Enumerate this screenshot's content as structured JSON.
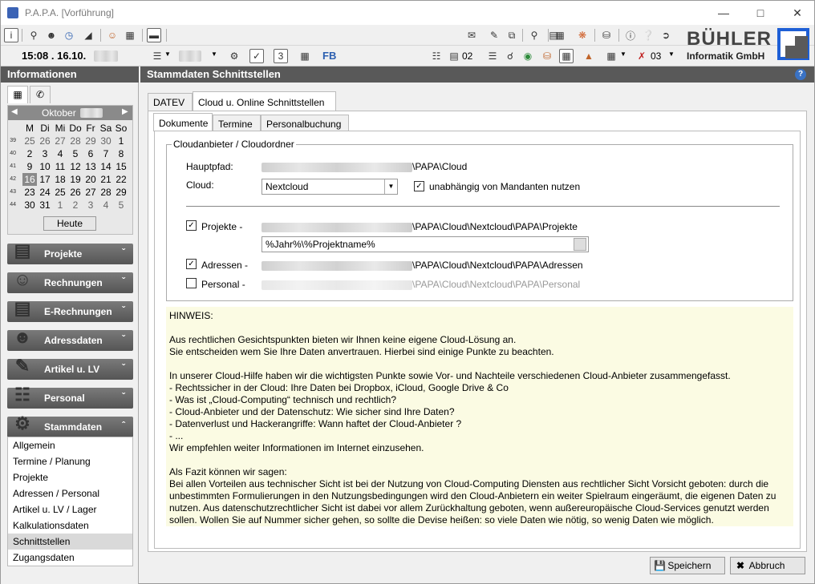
{
  "window": {
    "title": "P.A.P.A. [Vorführung]"
  },
  "toolbar2": {
    "clock": "15:08 . 16.10.",
    "fb_label": "FB",
    "counter1": "02",
    "counter2": "03"
  },
  "brand": {
    "name": "BÜHLER",
    "sub": "Informatik GmbH"
  },
  "left": {
    "header": "Informationen",
    "calendar": {
      "month": "Oktober",
      "weekdays": [
        "M",
        "Di",
        "Mi",
        "Do",
        "Fr",
        "Sa",
        "So"
      ],
      "weeks": [
        {
          "wk": "39",
          "days": [
            "25",
            "26",
            "27",
            "28",
            "29",
            "30",
            "1"
          ]
        },
        {
          "wk": "40",
          "days": [
            "2",
            "3",
            "4",
            "5",
            "6",
            "7",
            "8"
          ]
        },
        {
          "wk": "41",
          "days": [
            "9",
            "10",
            "11",
            "12",
            "13",
            "14",
            "15"
          ]
        },
        {
          "wk": "42",
          "days": [
            "16",
            "17",
            "18",
            "19",
            "20",
            "21",
            "22"
          ]
        },
        {
          "wk": "43",
          "days": [
            "23",
            "24",
            "25",
            "26",
            "27",
            "28",
            "29"
          ]
        },
        {
          "wk": "44",
          "days": [
            "30",
            "31",
            "1",
            "2",
            "3",
            "4",
            "5"
          ]
        }
      ],
      "today_label": "Heute"
    },
    "nav": [
      {
        "label": "Projekte"
      },
      {
        "label": "Rechnungen"
      },
      {
        "label": "E-Rechnungen"
      },
      {
        "label": "Adressdaten"
      },
      {
        "label": "Artikel u. LV"
      },
      {
        "label": "Personal"
      },
      {
        "label": "Stammdaten"
      }
    ],
    "submenu": [
      "Allgemein",
      "Termine / Planung",
      "Projekte",
      "Adressen / Personal",
      "Artikel u. LV / Lager",
      "Kalkulationsdaten",
      "Schnittstellen",
      "Zugangsdaten"
    ]
  },
  "main": {
    "header": "Stammdaten Schnittstellen",
    "tabs": [
      "DATEV",
      "Cloud u. Online Schnittstellen"
    ],
    "subtabs": [
      "Dokumente",
      "Termine",
      "Personalbuchung"
    ],
    "group_title": "Cloudanbieter / Cloudordner",
    "hauptpfad_label": "Hauptpfad:",
    "hauptpfad_value": "\\PAPA\\Cloud",
    "cloud_label": "Cloud:",
    "cloud_value": "Nextcloud",
    "independent_label": "unabhängig von Mandanten nutzen",
    "projekte_label": "Projekte -",
    "projekte_path": "\\PAPA\\Cloud\\Nextcloud\\PAPA\\Projekte",
    "projekte_pattern": "%Jahr%\\%Projektname%",
    "adressen_label": "Adressen -",
    "adressen_path": "\\PAPA\\Cloud\\Nextcloud\\PAPA\\Adressen",
    "personal_label": "Personal -",
    "personal_path": "\\PAPA\\Cloud\\Nextcloud\\PAPA\\Personal",
    "hint": "HINWEIS:\n\nAus rechtlichen Gesichtspunkten bieten wir Ihnen keine eigene Cloud-Lösung an.\nSie entscheiden wem Sie Ihre Daten anvertrauen. Hierbei sind einige Punkte zu beachten.\n\nIn unserer Cloud-Hilfe haben wir die wichtigsten Punkte sowie Vor- und Nachteile verschiedenen Cloud-Anbieter zusammengefasst.\n- Rechtssicher in der Cloud: Ihre Daten bei Dropbox, iCloud, Google Drive & Co\n- Was ist „Cloud-Computing“ technisch und rechtlich?\n- Cloud-Anbieter und der Datenschutz: Wie sicher sind Ihre Daten?\n- Datenverlust und Hackerangriffe: Wann haftet der Cloud-Anbieter ?\n- ...\nWir empfehlen weiter Informationen im Internet einzusehen.\n\nAls Fazit können wir sagen:\nBei allen Vorteilen aus technischer Sicht ist bei der Nutzung von Cloud-Computing Diensten aus rechtlicher Sicht Vorsicht geboten: durch die unbestimmten Formulierungen in den Nutzungsbedingungen wird den Cloud-Anbietern ein weiter Spielraum eingeräumt, die eigenen Daten zu nutzen. Aus datenschutzrechtlicher Sicht ist dabei vor allem Zurückhaltung geboten, wenn außereuropäische Cloud-Services genutzt werden sollen. Wollen Sie auf Nummer sicher gehen, so sollte die Devise heißen: so viele Daten wie nötig, so wenig Daten wie möglich.",
    "save_label": "Speichern",
    "cancel_label": "Abbruch"
  }
}
